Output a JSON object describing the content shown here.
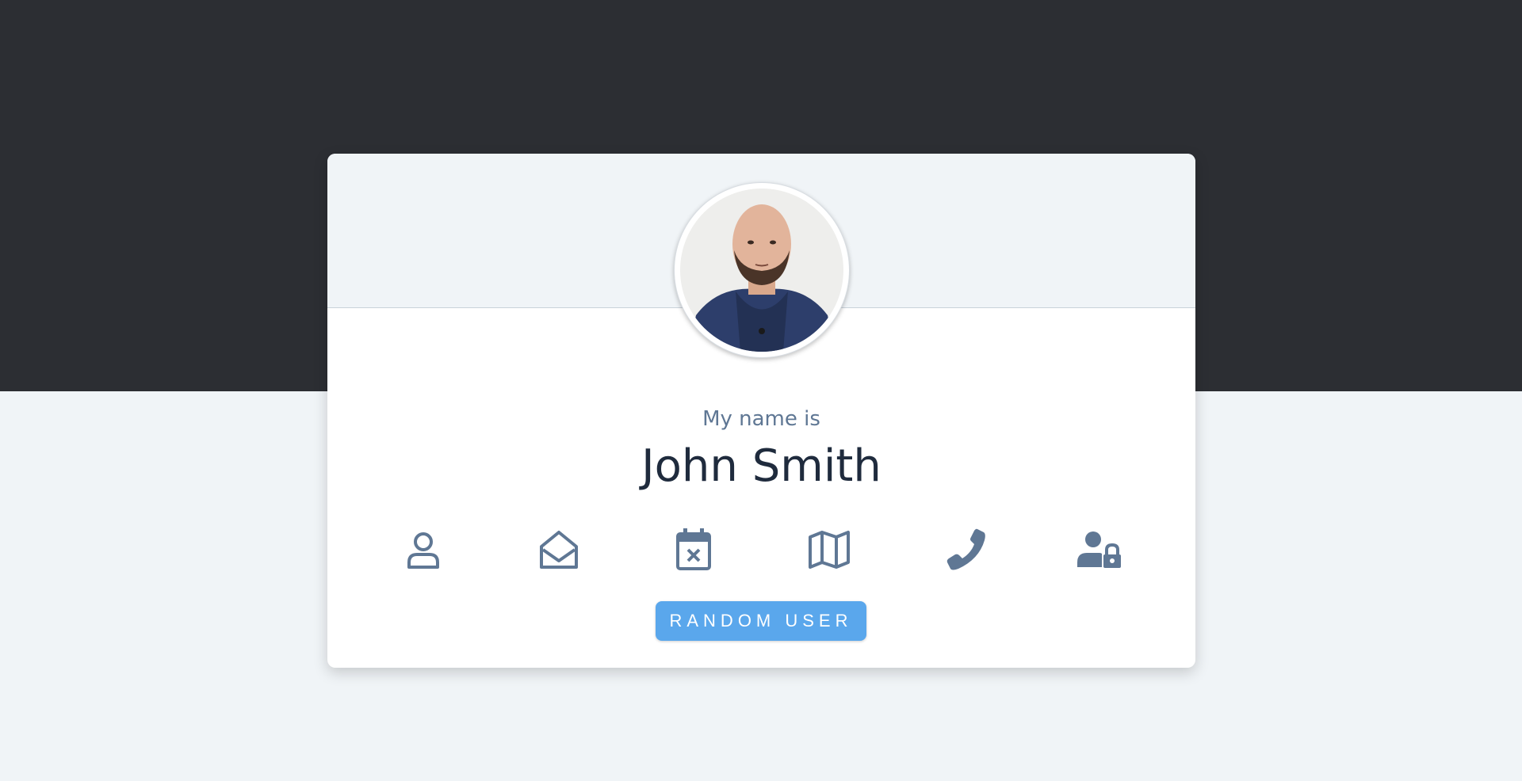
{
  "profile": {
    "label": "My name is",
    "name": "John Smith"
  },
  "icons": [
    {
      "id": "person",
      "name": "person-outline-icon",
      "title": "Name"
    },
    {
      "id": "mail",
      "name": "envelope-open-icon",
      "title": "Email"
    },
    {
      "id": "calendar",
      "name": "calendar-x-icon",
      "title": "Birthday"
    },
    {
      "id": "map",
      "name": "map-icon",
      "title": "Address"
    },
    {
      "id": "phone",
      "name": "phone-icon",
      "title": "Phone"
    },
    {
      "id": "lock",
      "name": "user-lock-icon",
      "title": "Password"
    }
  ],
  "button": {
    "label": "RANDOM USER"
  },
  "colors": {
    "dark_band": "#2c2e33",
    "background": "#f0f4f7",
    "icon": "#5f7794",
    "accent": "#5aa7ec",
    "name_text": "#1f2b3d"
  }
}
